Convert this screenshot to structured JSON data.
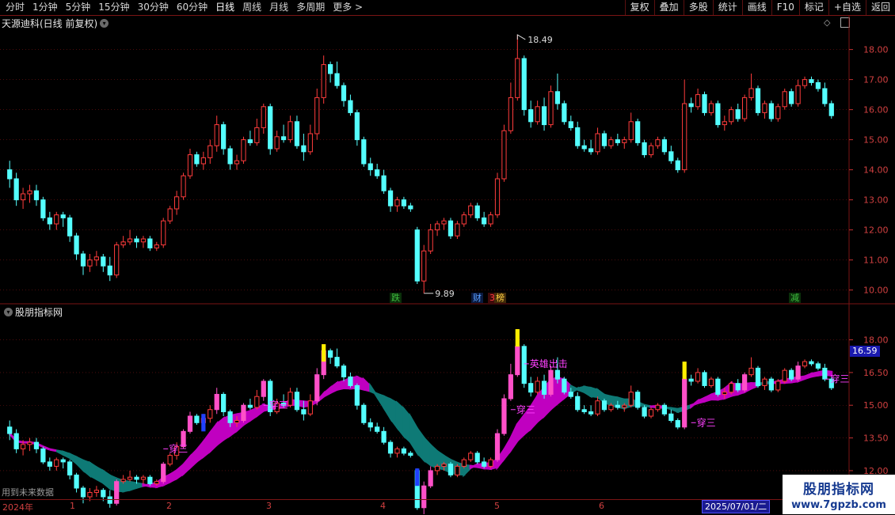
{
  "toolbar": {
    "periods": [
      "分时",
      "1分钟",
      "5分钟",
      "15分钟",
      "30分钟",
      "60分钟",
      "日线",
      "周线",
      "月线",
      "多周期",
      "更多"
    ],
    "more_arrow": ">",
    "buttons": [
      "复权",
      "叠加",
      "多股",
      "统计",
      "画线",
      "F10",
      "标记",
      "+自选",
      "返回"
    ]
  },
  "main_panel": {
    "title": "天源迪科(日线 前复权)",
    "title_icon": "chevron-down-icon",
    "right_icons": [
      "diamond-icon",
      "panel-toggle-icon"
    ],
    "high_label": "18.49",
    "low_label": "9.89",
    "y_ticks": [
      "18.00",
      "17.00",
      "16.00",
      "15.00",
      "14.00",
      "13.00",
      "12.00",
      "11.00",
      "10.00"
    ],
    "badges": [
      {
        "text": "跌",
        "color": "#3fbf3f",
        "bg": "#0a300a"
      },
      {
        "text": "财",
        "color": "#5aa0ff",
        "bg": "#0a1a40"
      },
      {
        "text": "3",
        "color": "#ff4040",
        "bg": "#400a0a"
      },
      {
        "text": "榜",
        "color": "#ffd040",
        "bg": "#402a0a"
      },
      {
        "text": "减",
        "color": "#3fbf3f",
        "bg": "#0a300a"
      }
    ]
  },
  "indicator_panel": {
    "title": "股朋指标网",
    "title_icon": "chevron-down-icon",
    "y_ticks": [
      "18.00",
      "16.50",
      "15.00",
      "13.50",
      "12.00"
    ],
    "current_price": "16.59",
    "labels": [
      "穿三",
      "穿三",
      "穿三",
      "穿三",
      "英雄出击",
      "穿三"
    ],
    "future_note": "用到未来数据"
  },
  "date_axis": {
    "year": "2024年",
    "months": [
      "1",
      "2",
      "3",
      "4",
      "5",
      "6"
    ],
    "selected_date": "2025/07/01/二"
  },
  "watermark": {
    "line1": "股朋指标网",
    "line2": "www.7gpzb.com"
  },
  "colors": {
    "up": "#ff3c3c",
    "down": "#54ffff",
    "ribbon_up": "#c000c0",
    "ribbon_down": "#0e7a76",
    "grid": "#7a1414"
  },
  "chart_data": {
    "type": "candlestick",
    "ylim": [
      9.7,
      18.7
    ],
    "indicator_ylim": [
      10.8,
      19.0
    ],
    "ohlc": [
      [
        14.0,
        14.3,
        13.4,
        13.7
      ],
      [
        13.7,
        13.9,
        12.8,
        13.0
      ],
      [
        13.0,
        13.4,
        12.7,
        13.2
      ],
      [
        13.2,
        13.5,
        12.9,
        13.3
      ],
      [
        13.3,
        13.5,
        12.8,
        13.0
      ],
      [
        13.0,
        13.1,
        12.3,
        12.4
      ],
      [
        12.4,
        12.6,
        12.0,
        12.2
      ],
      [
        12.2,
        12.6,
        12.0,
        12.5
      ],
      [
        12.5,
        12.6,
        12.1,
        12.4
      ],
      [
        12.4,
        12.5,
        11.6,
        11.8
      ],
      [
        11.8,
        11.9,
        11.0,
        11.2
      ],
      [
        11.2,
        11.3,
        10.5,
        10.8
      ],
      [
        10.8,
        11.2,
        10.6,
        11.0
      ],
      [
        11.0,
        11.3,
        10.8,
        11.1
      ],
      [
        11.1,
        11.2,
        10.6,
        10.8
      ],
      [
        10.8,
        11.1,
        10.3,
        10.5
      ],
      [
        10.5,
        11.6,
        10.4,
        11.5
      ],
      [
        11.5,
        11.8,
        11.4,
        11.6
      ],
      [
        11.6,
        12.0,
        11.5,
        11.7
      ],
      [
        11.7,
        11.8,
        11.4,
        11.6
      ],
      [
        11.6,
        11.8,
        11.4,
        11.7
      ],
      [
        11.7,
        11.8,
        11.3,
        11.4
      ],
      [
        11.4,
        11.6,
        11.3,
        11.5
      ],
      [
        11.5,
        12.4,
        11.4,
        12.3
      ],
      [
        12.3,
        12.8,
        12.2,
        12.7
      ],
      [
        12.7,
        13.3,
        12.5,
        13.1
      ],
      [
        13.1,
        13.9,
        13.0,
        13.8
      ],
      [
        13.8,
        14.7,
        13.7,
        14.5
      ],
      [
        14.5,
        14.6,
        14.1,
        14.2
      ],
      [
        14.2,
        14.6,
        14.0,
        14.4
      ],
      [
        14.4,
        15.0,
        14.2,
        14.8
      ],
      [
        14.8,
        15.8,
        14.6,
        15.5
      ],
      [
        15.5,
        15.6,
        14.5,
        14.7
      ],
      [
        14.7,
        14.8,
        14.0,
        14.2
      ],
      [
        14.2,
        14.5,
        14.0,
        14.3
      ],
      [
        14.3,
        15.1,
        14.2,
        15.0
      ],
      [
        15.0,
        15.3,
        14.8,
        14.9
      ],
      [
        14.9,
        15.7,
        14.8,
        15.4
      ],
      [
        15.4,
        16.2,
        15.2,
        16.1
      ],
      [
        16.1,
        16.2,
        14.5,
        14.7
      ],
      [
        14.7,
        15.3,
        14.6,
        15.1
      ],
      [
        15.1,
        15.5,
        14.9,
        15.0
      ],
      [
        15.0,
        15.8,
        14.9,
        15.6
      ],
      [
        15.6,
        15.8,
        14.7,
        14.8
      ],
      [
        14.8,
        15.2,
        14.3,
        14.6
      ],
      [
        14.6,
        15.5,
        14.5,
        15.2
      ],
      [
        15.2,
        16.7,
        15.0,
        16.4
      ],
      [
        16.4,
        17.8,
        16.2,
        17.5
      ],
      [
        17.5,
        17.6,
        16.9,
        17.2
      ],
      [
        17.2,
        17.6,
        16.7,
        16.8
      ],
      [
        16.8,
        16.9,
        16.1,
        16.3
      ],
      [
        16.3,
        16.5,
        15.8,
        15.9
      ],
      [
        15.9,
        16.0,
        14.8,
        15.0
      ],
      [
        15.0,
        15.1,
        14.1,
        14.2
      ],
      [
        14.2,
        14.4,
        13.8,
        14.0
      ],
      [
        14.0,
        14.2,
        13.7,
        13.8
      ],
      [
        13.8,
        14.0,
        13.2,
        13.3
      ],
      [
        13.3,
        13.4,
        12.6,
        12.8
      ],
      [
        12.8,
        13.1,
        12.6,
        13.0
      ],
      [
        13.0,
        13.1,
        12.7,
        12.8
      ],
      [
        12.8,
        12.9,
        12.6,
        12.7
      ],
      [
        12.0,
        12.1,
        10.2,
        10.3
      ],
      [
        10.3,
        11.5,
        9.89,
        11.3
      ],
      [
        11.3,
        12.2,
        11.2,
        12.0
      ],
      [
        12.0,
        12.3,
        11.8,
        12.2
      ],
      [
        12.2,
        12.4,
        12.0,
        12.3
      ],
      [
        12.3,
        12.4,
        11.7,
        11.8
      ],
      [
        11.8,
        12.3,
        11.7,
        12.2
      ],
      [
        12.2,
        12.6,
        12.1,
        12.5
      ],
      [
        12.5,
        12.9,
        12.4,
        12.8
      ],
      [
        12.8,
        12.9,
        12.3,
        12.4
      ],
      [
        12.4,
        12.6,
        12.1,
        12.2
      ],
      [
        12.2,
        12.6,
        12.1,
        12.5
      ],
      [
        12.5,
        13.9,
        12.4,
        13.7
      ],
      [
        13.7,
        15.5,
        13.6,
        15.3
      ],
      [
        15.3,
        16.9,
        15.2,
        16.4
      ],
      [
        16.4,
        18.49,
        16.3,
        17.7
      ],
      [
        17.7,
        17.8,
        15.8,
        16.0
      ],
      [
        16.0,
        16.3,
        15.4,
        15.6
      ],
      [
        15.6,
        16.3,
        15.5,
        16.1
      ],
      [
        16.1,
        16.4,
        15.3,
        15.5
      ],
      [
        15.5,
        16.8,
        15.4,
        16.6
      ],
      [
        16.6,
        17.2,
        16.0,
        16.2
      ],
      [
        16.2,
        16.3,
        15.5,
        15.6
      ],
      [
        15.6,
        15.8,
        15.3,
        15.4
      ],
      [
        15.4,
        15.6,
        14.7,
        14.8
      ],
      [
        14.8,
        15.0,
        14.6,
        14.7
      ],
      [
        14.7,
        15.0,
        14.5,
        14.6
      ],
      [
        14.6,
        15.4,
        14.5,
        15.2
      ],
      [
        15.2,
        15.3,
        14.7,
        14.8
      ],
      [
        14.8,
        15.1,
        14.7,
        15.0
      ],
      [
        15.0,
        15.2,
        14.8,
        14.9
      ],
      [
        14.9,
        15.1,
        14.7,
        15.0
      ],
      [
        15.0,
        15.9,
        14.9,
        15.6
      ],
      [
        15.6,
        15.7,
        14.8,
        14.9
      ],
      [
        14.9,
        15.0,
        14.4,
        14.5
      ],
      [
        14.5,
        14.9,
        14.4,
        14.8
      ],
      [
        14.8,
        15.1,
        14.7,
        15.0
      ],
      [
        15.0,
        15.1,
        14.5,
        14.6
      ],
      [
        14.6,
        14.8,
        14.2,
        14.3
      ],
      [
        14.3,
        14.4,
        13.9,
        14.0
      ],
      [
        14.0,
        17.0,
        13.9,
        16.2
      ],
      [
        16.2,
        16.4,
        15.9,
        16.1
      ],
      [
        16.1,
        16.7,
        16.0,
        16.5
      ],
      [
        16.5,
        16.6,
        15.8,
        15.9
      ],
      [
        15.9,
        16.3,
        15.8,
        16.2
      ],
      [
        16.2,
        16.3,
        15.4,
        15.5
      ],
      [
        15.5,
        15.8,
        15.3,
        15.6
      ],
      [
        15.6,
        16.1,
        15.5,
        16.0
      ],
      [
        16.0,
        16.2,
        15.6,
        15.7
      ],
      [
        15.7,
        16.5,
        15.6,
        16.4
      ],
      [
        16.4,
        17.2,
        16.3,
        16.7
      ],
      [
        16.7,
        16.8,
        15.8,
        15.9
      ],
      [
        15.9,
        16.3,
        15.7,
        16.2
      ],
      [
        16.2,
        16.3,
        15.6,
        15.7
      ],
      [
        15.7,
        16.2,
        15.6,
        16.1
      ],
      [
        16.1,
        16.7,
        16.0,
        16.6
      ],
      [
        16.6,
        16.7,
        16.1,
        16.2
      ],
      [
        16.2,
        17.0,
        16.1,
        16.8
      ],
      [
        16.8,
        17.1,
        16.7,
        17.0
      ],
      [
        17.0,
        17.1,
        16.8,
        16.9
      ],
      [
        16.9,
        17.0,
        16.6,
        16.7
      ],
      [
        16.7,
        16.9,
        16.1,
        16.2
      ],
      [
        16.2,
        16.3,
        15.7,
        15.8
      ]
    ]
  }
}
